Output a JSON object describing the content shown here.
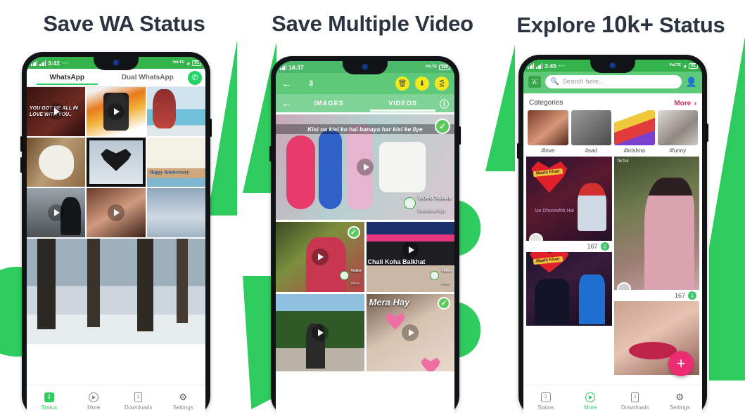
{
  "theme": {
    "green": "#2ecc5f",
    "green_dark": "#34b34c",
    "yellow": "#f2e91d",
    "pink": "#ec2c72",
    "accent_text": "#2b3440"
  },
  "headlines": [
    {
      "text": "Save WA Status"
    },
    {
      "text": "Save Multiple Video"
    },
    {
      "pre": "Explore ",
      "big": "10k+",
      "post": " Status"
    }
  ],
  "phone1": {
    "status_bar": {
      "time": "3:42",
      "net1": "4G",
      "net2": "4G",
      "dots": "⋯",
      "vowifi": "VoLTE",
      "battery": "91"
    },
    "tabs": [
      {
        "label": "WhatsApp",
        "active": true
      },
      {
        "label": "Dual WhatsApp",
        "active": false
      }
    ],
    "wa_icon": "whatsapp-icon",
    "grid": [
      {
        "name": "status-tile-1",
        "caption": "YOU GOT ME ALL IN LOVE WITH YOU..",
        "video": true
      },
      {
        "name": "status-tile-2",
        "caption": "",
        "video": true
      },
      {
        "name": "status-tile-3",
        "caption": "",
        "video": false
      },
      {
        "name": "status-tile-4",
        "caption": "",
        "video": false
      },
      {
        "name": "status-tile-5",
        "caption": "",
        "video": false
      },
      {
        "name": "status-tile-6",
        "caption": "Happy Anniversary",
        "video": false
      },
      {
        "name": "status-tile-7",
        "caption": "",
        "video": true
      },
      {
        "name": "status-tile-8",
        "caption": "",
        "video": true
      },
      {
        "name": "status-tile-9",
        "caption": "",
        "video": false
      }
    ],
    "bottom_nav": [
      {
        "label": "Status",
        "icon": "status-icon",
        "active": true
      },
      {
        "label": "More",
        "icon": "play-circle-icon",
        "active": false
      },
      {
        "label": "Downloads",
        "icon": "download-phone-icon",
        "active": false
      },
      {
        "label": "Settings",
        "icon": "gear-icon",
        "active": false
      }
    ]
  },
  "phone2": {
    "status_bar": {
      "time": "14:37",
      "net1": "4G",
      "vowifi": "VoLTE",
      "battery": "100"
    },
    "toolbar": {
      "back": "back-arrow-icon",
      "count": "3",
      "actions": [
        {
          "name": "delete-button",
          "glyph": "🗑"
        },
        {
          "name": "download-button",
          "glyph": "⬇"
        },
        {
          "name": "share-button",
          "glyph": "≪"
        }
      ]
    },
    "tabs": [
      {
        "label": "IMAGES",
        "active": false
      },
      {
        "label": "VIDEOS",
        "active": true
      }
    ],
    "help_icon": "help-circle-icon",
    "items": [
      {
        "name": "video-card-hero",
        "caption": "Kisi na kisi ko hai banaya har kisi ke liye",
        "selected": true,
        "watermark": true,
        "wm_title": "Video Status",
        "wm_sub": "Download App"
      },
      {
        "name": "video-card-2",
        "caption": "",
        "selected": true,
        "watermark": true,
        "wm_title": "Video",
        "wm_sub": "Status"
      },
      {
        "name": "video-card-3",
        "caption": "Chali Koha Balkhat",
        "selected": false,
        "watermark": true,
        "wm_title": "Video",
        "wm_sub": "Status"
      },
      {
        "name": "video-card-4",
        "caption": "",
        "selected": false,
        "watermark": false
      },
      {
        "name": "video-card-5",
        "caption": "Mera Hay",
        "selected": true,
        "watermark": false
      }
    ]
  },
  "phone3": {
    "status_bar": {
      "time": "3:45",
      "net1": "4G",
      "net2": "4G",
      "dots": "⋯",
      "vowifi": "VoLTE",
      "battery": "91"
    },
    "search": {
      "placeholder": "Search here...",
      "lang_icon": "translate-icon",
      "search_icon": "search-icon",
      "profile_icon": "profile-icon"
    },
    "categories_title": "Categories",
    "more_label": "More",
    "more_chevron": "›",
    "categories": [
      {
        "label": "#love"
      },
      {
        "label": "#sad"
      },
      {
        "label": "#krishna"
      },
      {
        "label": "#funny"
      }
    ],
    "feed": [
      {
        "name": "feed-card-1",
        "title": "Maahi Khan",
        "subtitle": "Ise Dhoondhti Hai",
        "count": "167",
        "download_icon": "download-icon",
        "source": ""
      },
      {
        "name": "feed-card-2",
        "title": "",
        "subtitle": "",
        "count": "167",
        "download_icon": "download-icon",
        "source": "TikTok"
      },
      {
        "name": "feed-card-3",
        "title": "Maahi Khan",
        "subtitle": "",
        "count": "",
        "download_icon": "",
        "source": ""
      },
      {
        "name": "feed-card-4",
        "title": "",
        "subtitle": "",
        "count": "",
        "download_icon": "",
        "source": ""
      }
    ],
    "fab_label": "+",
    "bottom_nav": [
      {
        "label": "Status",
        "icon": "status-icon",
        "active": false
      },
      {
        "label": "More",
        "icon": "play-circle-icon",
        "active": true
      },
      {
        "label": "Downloads",
        "icon": "download-phone-icon",
        "active": false
      },
      {
        "label": "Settings",
        "icon": "gear-icon",
        "active": false
      }
    ]
  }
}
